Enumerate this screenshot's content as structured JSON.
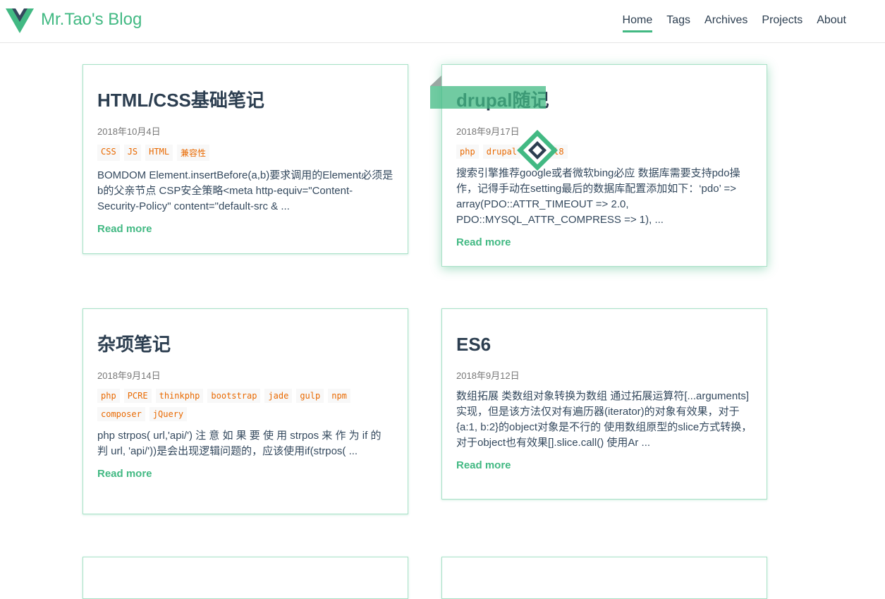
{
  "header": {
    "brand": "Mr.Tao's Blog",
    "nav": [
      "Home",
      "Tags",
      "Archives",
      "Projects",
      "About"
    ],
    "active": "Home"
  },
  "colors": {
    "accent": "#42b983",
    "text": "#2c3e50",
    "tag": "#e96900"
  },
  "posts": [
    {
      "title": "HTML/CSS基础笔记",
      "date": "2018年10月4日",
      "tags": [
        "CSS",
        "JS",
        "HTML",
        "兼容性"
      ],
      "excerpt": "BOMDOM Element.insertBefore(a,b)要求调用的Element必须是b的父亲节点 CSP安全策略<meta http-equiv=\"Content-Security-Policy\" content=\"default-src & ...",
      "read_more": "Read more"
    },
    {
      "title": "drupal随记",
      "date": "2018年9月17日",
      "tags": [
        "php",
        "drupal",
        "drupal8"
      ],
      "excerpt": "搜索引擎推荐google或者微软bing必应 数据库需要支持pdo操作，记得手动在setting最后的数据库配置添加如下：‘pdo’ => array(PDO::ATTR_TIMEOUT => 2.0, PDO::MYSQL_ATTR_COMPRESS => 1), ...",
      "read_more": "Read more"
    },
    {
      "title": "杂项笔记",
      "date": "2018年9月14日",
      "tags": [
        "php",
        "PCRE",
        "thinkphp",
        "bootstrap",
        "jade",
        "gulp",
        "npm",
        "composer",
        "jQuery"
      ],
      "excerpt": "php strpos( url,'api/') 注 意 如 果 要 使 用 strpos 来 作 为 if 的 判 url, 'api/'))是会出现逻辑问题的，应该使用if(strpos( ...",
      "read_more": "Read more"
    },
    {
      "title": "ES6",
      "date": "2018年9月12日",
      "tags": [],
      "excerpt": "数组拓展 类数组对象转换为数组 通过拓展运算符[...arguments]实现，但是该方法仅对有遍历器(iterator)的对象有效果，对于{a:1, b:2}的object对象是不行的 使用数组原型的slice方式转换，对于object也有效果[].slice.call() 使用Ar ...",
      "read_more": "Read more"
    }
  ]
}
